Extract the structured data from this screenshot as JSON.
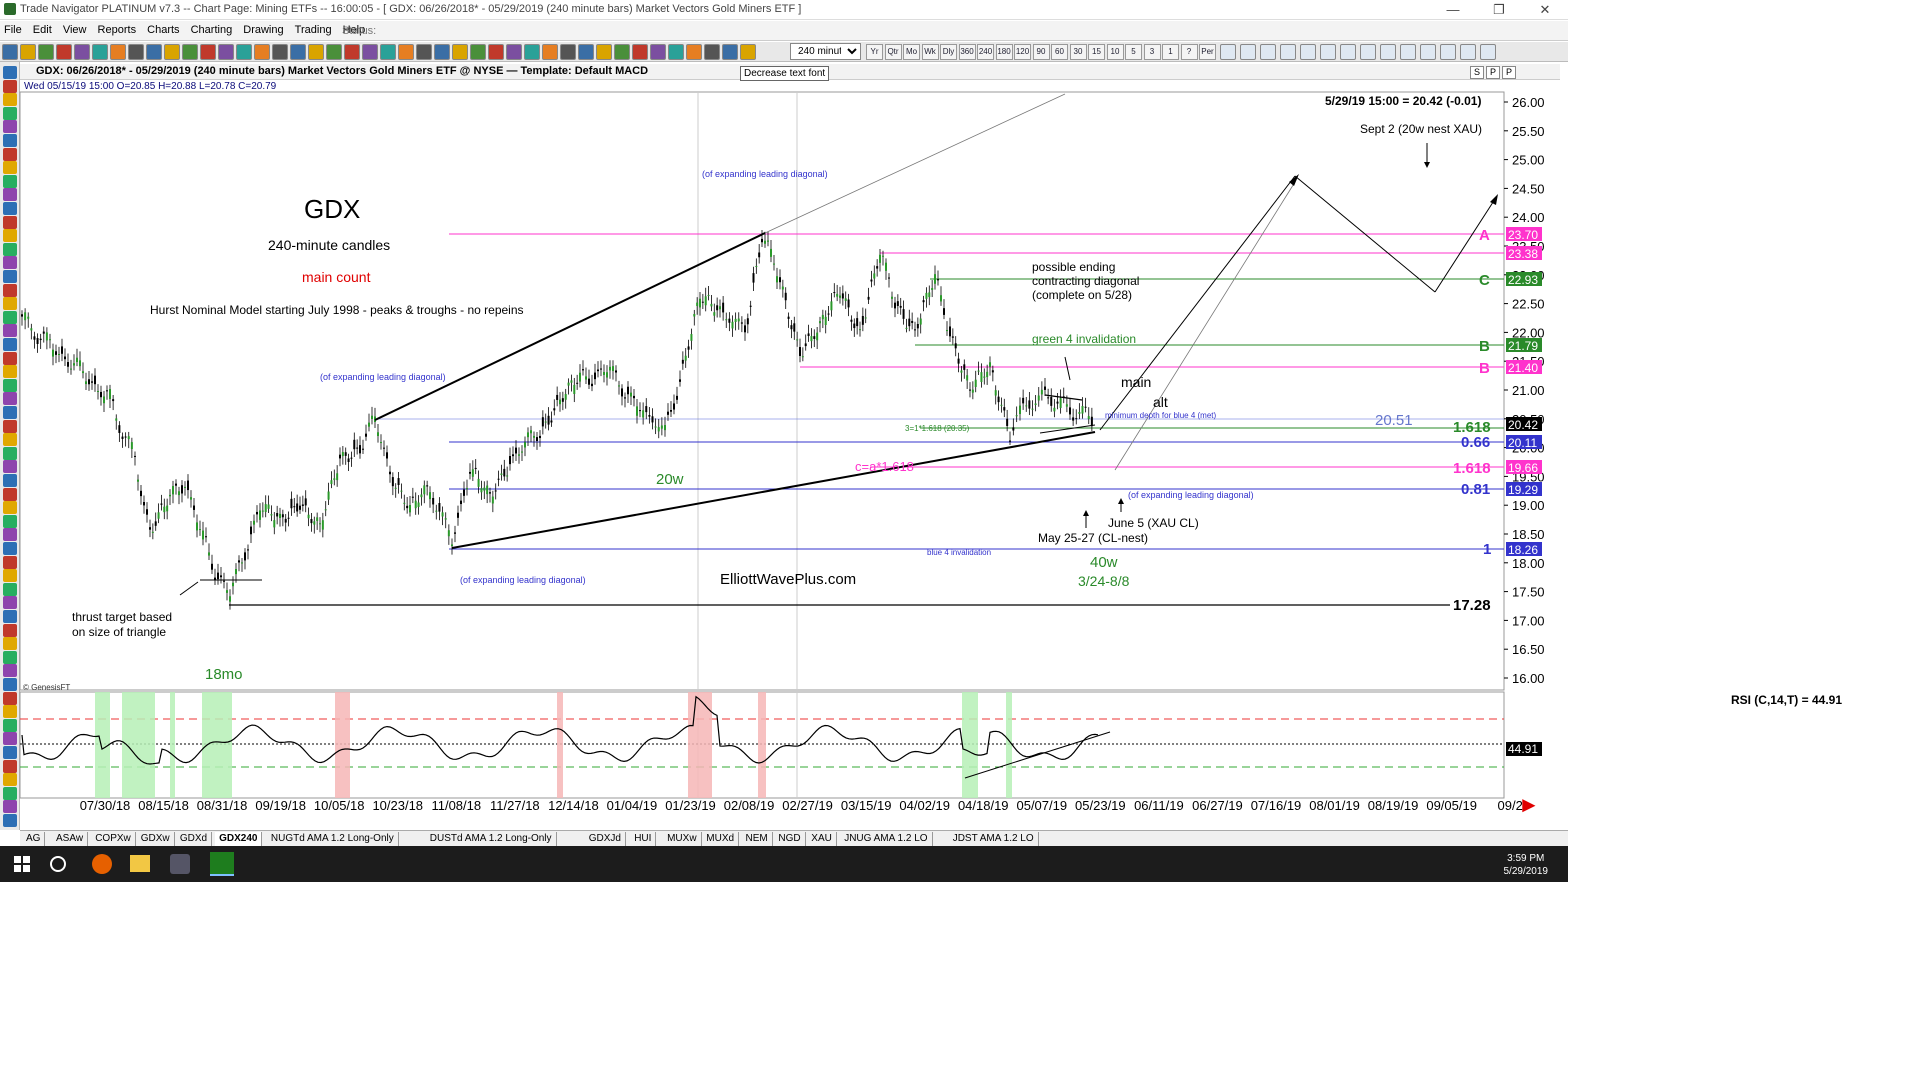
{
  "window": {
    "title": "Trade Navigator PLATINUM v7.3  --  Chart Page: Mining ETFs -- 16:00:05 - [ GDX:  06/26/2018* - 05/29/2019  (240 minute bars)   Market Vectors Gold Miners ETF ]"
  },
  "menu": {
    "items": [
      "File",
      "Edit",
      "View",
      "Reports",
      "Charts",
      "Charting",
      "Drawing",
      "Trading",
      "Help"
    ],
    "status_label": "Status:"
  },
  "toolbar": {
    "timeframe": "240 minute",
    "tooltip": "Decrease text font",
    "period_buttons": [
      "Yr",
      "Qtr",
      "Mo",
      "Wk",
      "Dly",
      "360",
      "240",
      "180",
      "120",
      "90",
      "60",
      "30",
      "15",
      "10",
      "5",
      "3",
      "1",
      "?",
      "Per"
    ]
  },
  "chart": {
    "header": "GDX:  06/26/2018* - 05/29/2019  (240 minute bars)   Market Vectors Gold Miners ETF @ NYSE  —  Template: Default MACD",
    "ohlc": "Wed  05/15/19 15:00   O=20.85   H=20.88   L=20.78   C=20.79",
    "last_price_label": "5/29/19 15:00 = 20.42 (-0.01)",
    "copyright": "© GenesisFT",
    "header_buttons": [
      "S",
      "P",
      "P"
    ],
    "rsi_label": "RSI (C,14,T) = 44.91",
    "rsi_value": "44.91",
    "title": "GDX",
    "subtitle": "240-minute candles",
    "count_label": "main count",
    "hurst_note": "Hurst Nominal Model starting July 1998 - peaks & troughs - no repeins",
    "watermark": "ElliottWavePlus.com",
    "notes": {
      "thrust": "thrust target based",
      "thrust2": "on size of triangle",
      "sept": "Sept 2 (20w nest XAU)",
      "possible1": "possible ending",
      "possible2": "contracting diagonal",
      "possible3": "(complete on 5/28)",
      "green_inval": "green 4 invalidation",
      "min_depth": "minimum depth for blue 4 (met)",
      "fib": "3=1*1.618 (20.35)",
      "c_eq": "c=a*1.618",
      "june5": "June 5 (XAU CL)",
      "may25": "May 25-27 (CL-nest)",
      "blue4inval": "blue 4 invalidation",
      "w40": "40w",
      "w40range": "3/24-8/8",
      "w20": "20w",
      "mo18": "18mo",
      "main": "main",
      "alt": "alt",
      "eld1": "(of expanding leading diagonal)",
      "eld2": "(of expanding leading diagonal)",
      "eld3": "(of expanding leading diagonal)",
      "eld4": "(of expanding leading diagonal)"
    },
    "price_ticks": [
      "26.00",
      "25.50",
      "25.00",
      "24.50",
      "24.00",
      "23.50",
      "23.00",
      "22.50",
      "22.00",
      "21.50",
      "21.00",
      "20.50",
      "20.00",
      "19.50",
      "19.00",
      "18.50",
      "18.00",
      "17.50",
      "17.00",
      "16.50",
      "16.00"
    ],
    "date_ticks": [
      "07/30/18",
      "08/15/18",
      "08/31/18",
      "09/19/18",
      "10/05/18",
      "10/23/18",
      "11/08/18",
      "11/27/18",
      "12/14/18",
      "01/04/19",
      "01/23/19",
      "02/08/19",
      "02/27/19",
      "03/15/19",
      "04/02/19",
      "04/18/19",
      "05/07/19",
      "05/23/19",
      "06/11/19",
      "06/27/19",
      "07/16/19",
      "08/01/19",
      "08/19/19",
      "09/05/19",
      "09/2"
    ],
    "level_labels": {
      "l2051": "20.51",
      "l1618a": "1.618",
      "l066": "0.66",
      "l1618b": "1.618",
      "l081": "0.81",
      "l1": "1",
      "l1728": "17.28",
      "A": "A",
      "B": "B",
      "C": "C"
    },
    "price_boxes": [
      "23.70",
      "23.38",
      "22.93",
      "21.79",
      "21.40",
      "20.42",
      "20.11",
      "19.66",
      "19.29",
      "18.26"
    ]
  },
  "tabs": [
    "AG",
    "ASAw",
    "COPXw",
    "GDXw",
    "GDXd",
    "GDX240",
    "NUGTd AMA 1.2 Long-Only",
    "DUSTd AMA 1.2 Long-Only",
    "GDXJd",
    "HUI",
    "MUXw",
    "MUXd",
    "NEM",
    "NGD",
    "XAU",
    "JNUG AMA 1.2 LO",
    "JDST AMA 1.2 LO"
  ],
  "taskbar": {
    "time": "3:59 PM",
    "date": "5/29/2019"
  }
}
